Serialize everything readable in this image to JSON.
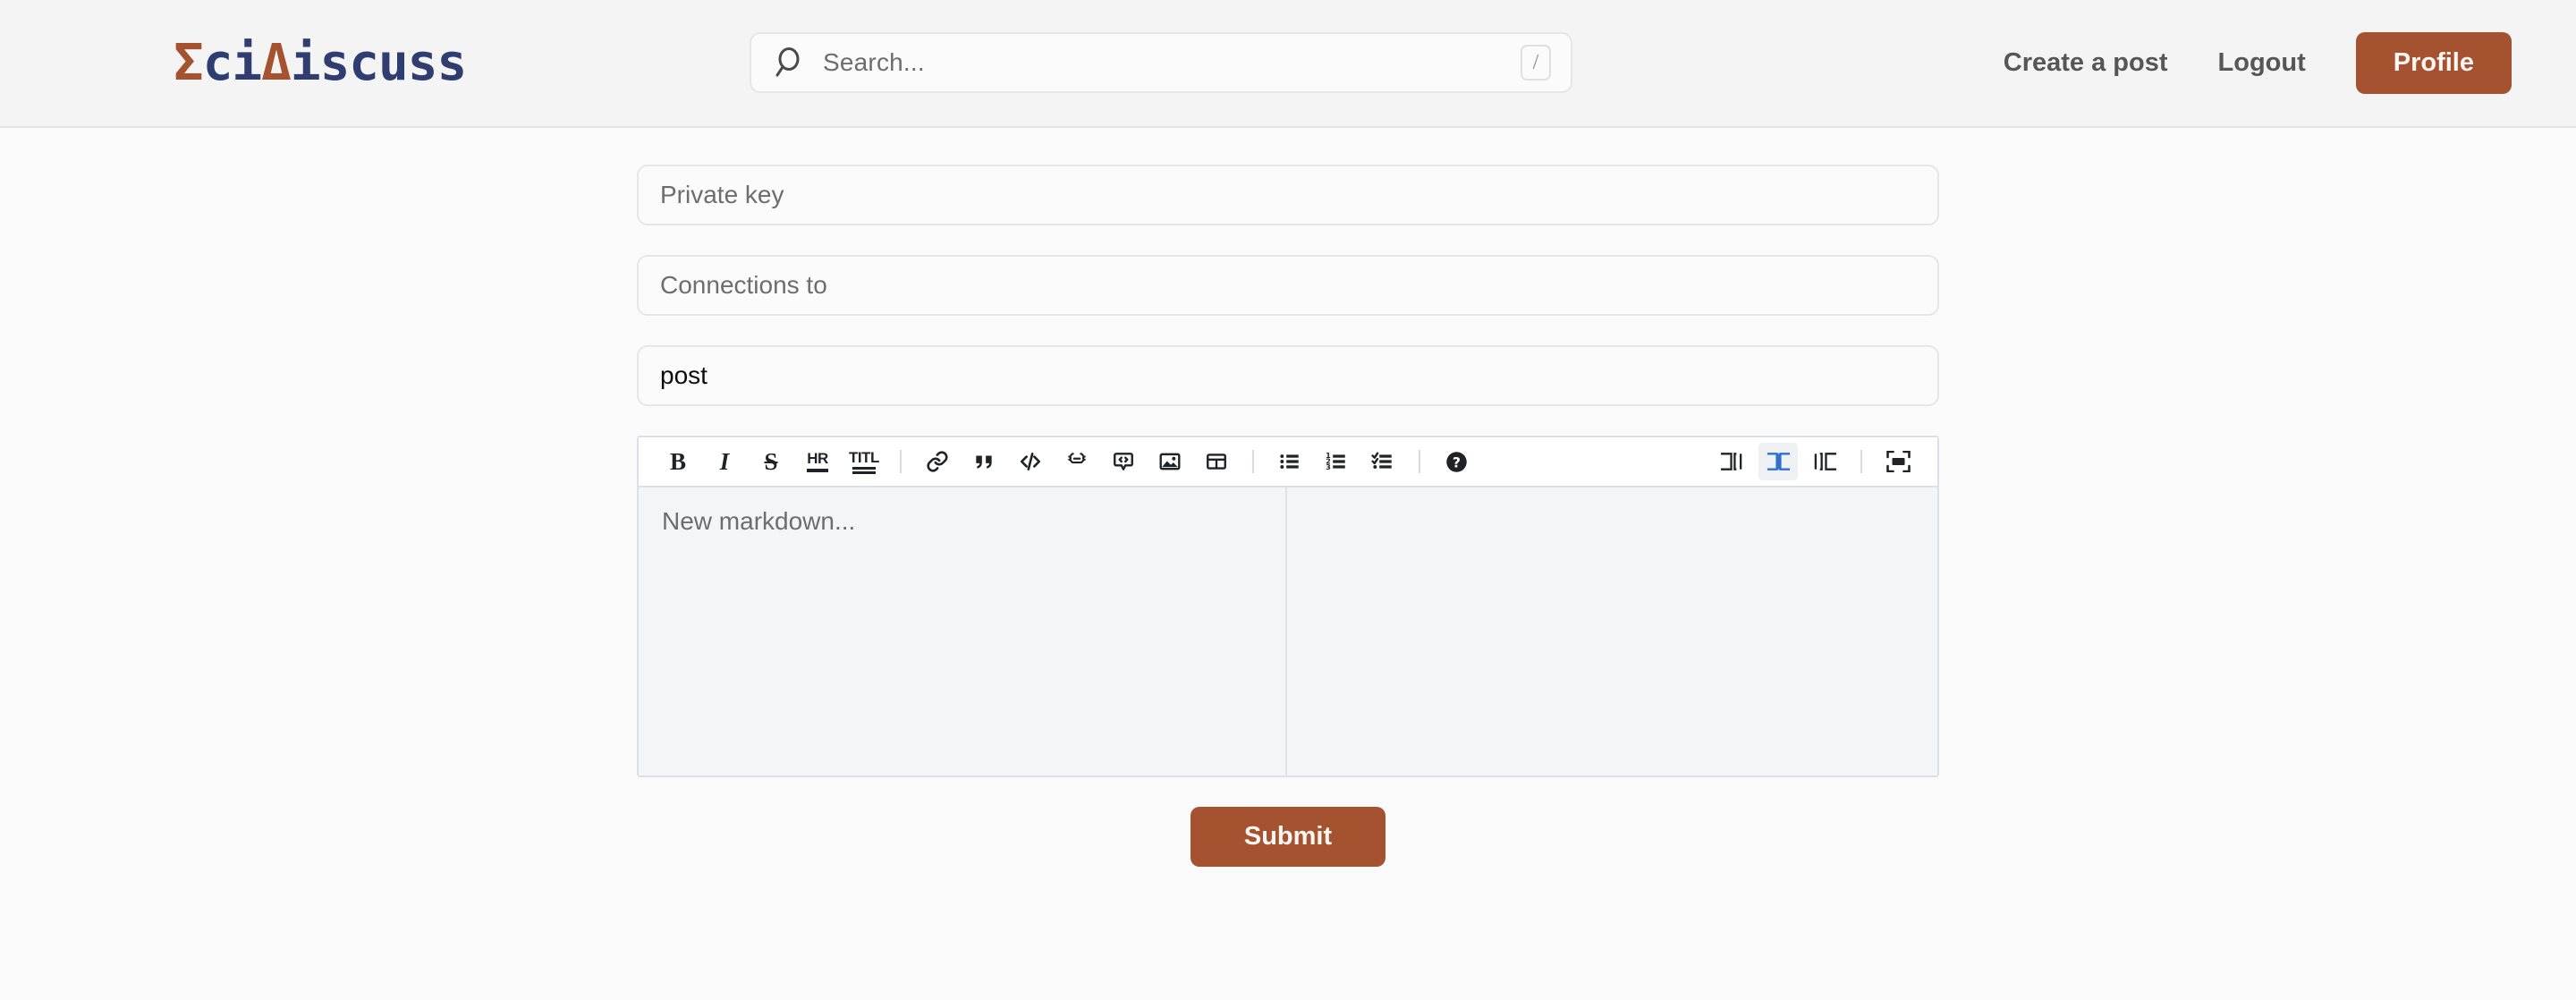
{
  "header": {
    "logo": {
      "full_text": "ΣciΔiscuss",
      "part_sigma": "Σ",
      "part_ci": "ci",
      "part_delta": "Δ",
      "part_iscuss": "iscuss",
      "accent_color": "#a4522f",
      "base_color": "#2f3d70"
    },
    "search": {
      "icon": "search-icon",
      "placeholder": "Search...",
      "shortcut_badge": "/"
    },
    "nav": {
      "create_post": "Create a post",
      "logout": "Logout",
      "profile": "Profile",
      "profile_color": "#a4522f"
    }
  },
  "form": {
    "private_key": {
      "placeholder": "Private key",
      "value": ""
    },
    "connections_to": {
      "placeholder": "Connections to",
      "value": ""
    },
    "title": {
      "placeholder": "",
      "value": "post"
    }
  },
  "editor": {
    "placeholder": "New markdown...",
    "content": "",
    "preview_content": "",
    "active_view_mode": "split",
    "toolbar_left": [
      {
        "name": "bold-icon",
        "label": "B",
        "kind": "serif-bold"
      },
      {
        "name": "italic-icon",
        "label": "I",
        "kind": "serif-italic"
      },
      {
        "name": "strikethrough-icon",
        "label": "S",
        "kind": "serif-strike"
      },
      {
        "name": "horizontal-rule-icon",
        "label": "HR",
        "kind": "stacked-1"
      },
      {
        "name": "title-icon",
        "label": "TITL",
        "kind": "stacked-2"
      },
      {
        "name": "separator",
        "label": "",
        "kind": "sep"
      },
      {
        "name": "link-icon",
        "label": "",
        "kind": "svg-link"
      },
      {
        "name": "quote-icon",
        "label": "",
        "kind": "svg-quote"
      },
      {
        "name": "code-icon",
        "label": "",
        "kind": "svg-code"
      },
      {
        "name": "code-block-icon",
        "label": "",
        "kind": "svg-codeblock"
      },
      {
        "name": "comment-code-icon",
        "label": "",
        "kind": "svg-comment"
      },
      {
        "name": "image-icon",
        "label": "",
        "kind": "svg-image"
      },
      {
        "name": "table-icon",
        "label": "",
        "kind": "svg-table"
      },
      {
        "name": "separator",
        "label": "",
        "kind": "sep"
      },
      {
        "name": "unordered-list-icon",
        "label": "",
        "kind": "svg-ul"
      },
      {
        "name": "ordered-list-icon",
        "label": "",
        "kind": "svg-ol"
      },
      {
        "name": "checklist-icon",
        "label": "",
        "kind": "svg-check"
      },
      {
        "name": "separator",
        "label": "",
        "kind": "sep"
      },
      {
        "name": "help-icon",
        "label": "",
        "kind": "svg-help"
      }
    ],
    "toolbar_right": [
      {
        "name": "view-mode-editor-icon",
        "active": false
      },
      {
        "name": "view-mode-split-icon",
        "active": true
      },
      {
        "name": "view-mode-preview-icon",
        "active": false
      },
      {
        "name": "separator",
        "active": false
      },
      {
        "name": "fullscreen-icon",
        "active": false
      }
    ],
    "active_color": "#2f6fd0"
  },
  "actions": {
    "submit": "Submit",
    "submit_color": "#a4522f"
  }
}
